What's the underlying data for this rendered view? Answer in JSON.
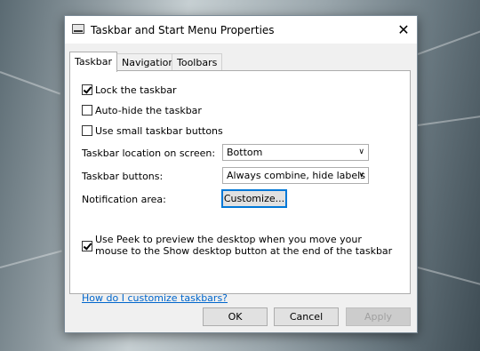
{
  "window": {
    "title": "Taskbar and Start Menu Properties",
    "close_glyph": "✕"
  },
  "tabs": [
    {
      "label": "Taskbar",
      "active": true
    },
    {
      "label": "Navigation",
      "active": false
    },
    {
      "label": "Toolbars",
      "active": false
    }
  ],
  "options": {
    "lock": {
      "label": "Lock the taskbar",
      "checked": true
    },
    "autohide": {
      "label": "Auto-hide the taskbar",
      "checked": false
    },
    "small_buttons": {
      "label": "Use small taskbar buttons",
      "checked": false
    }
  },
  "location": {
    "label": "Taskbar location on screen:",
    "value": "Bottom"
  },
  "taskbar_buttons": {
    "label": "Taskbar buttons:",
    "value": "Always combine, hide labels"
  },
  "notification": {
    "label": "Notification area:",
    "button": "Customize..."
  },
  "peek": {
    "label": "Use Peek to preview the desktop when you move your mouse to the Show desktop button at the end of the taskbar",
    "checked": true
  },
  "help_link": "How do I customize taskbars?",
  "buttons": {
    "ok": "OK",
    "cancel": "Cancel",
    "apply": "Apply"
  }
}
